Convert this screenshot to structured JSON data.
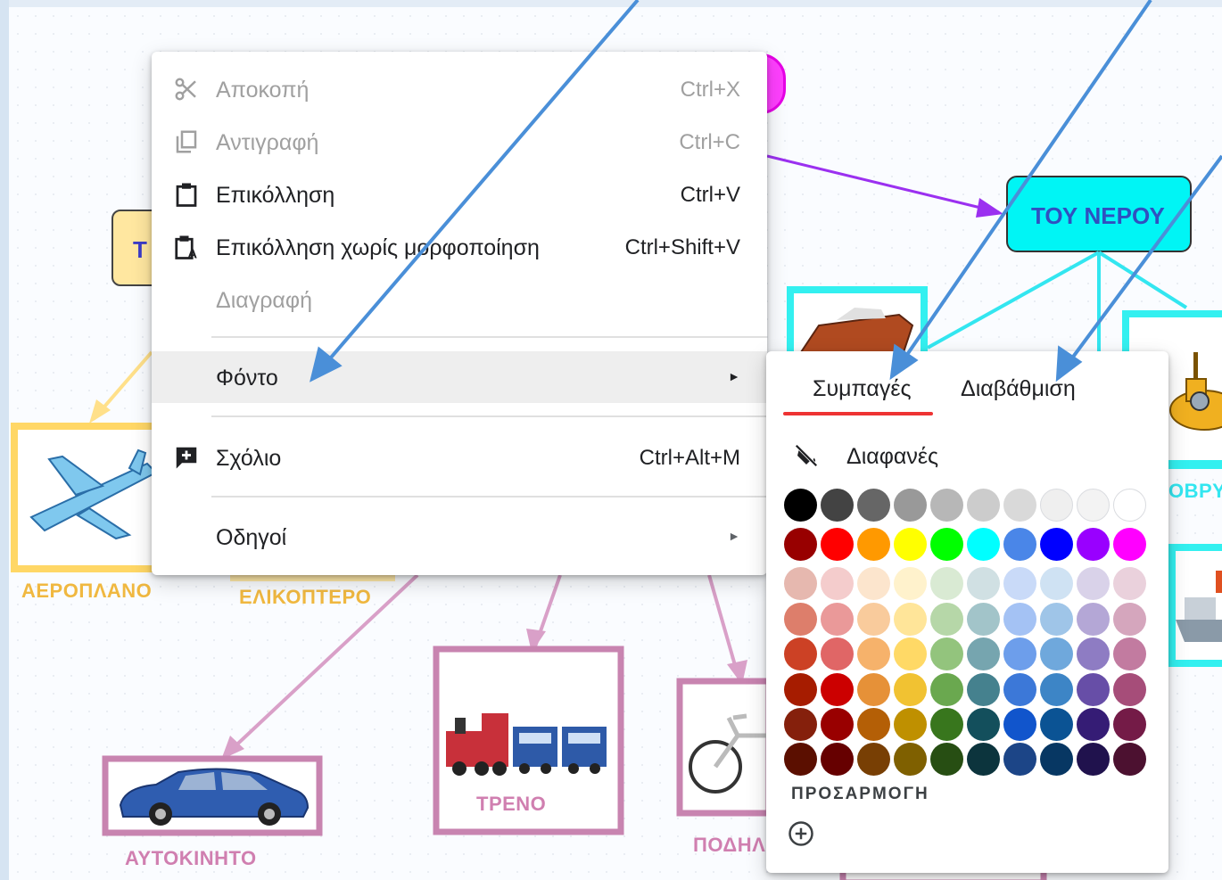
{
  "menu": {
    "items": [
      {
        "label": "Αποκοπή",
        "shortcut": "Ctrl+X",
        "icon": "scissors-icon"
      },
      {
        "label": "Αντιγραφή",
        "shortcut": "Ctrl+C",
        "icon": "copy-icon"
      },
      {
        "label": "Επικόλληση",
        "shortcut": "Ctrl+V",
        "icon": "paste-icon"
      },
      {
        "label": "Επικόλληση χωρίς μορφοποίηση",
        "shortcut": "Ctrl+Shift+V",
        "icon": "paste-plain-icon"
      },
      {
        "label": "Διαγραφή",
        "shortcut": ""
      },
      {
        "label": "Φόντο",
        "shortcut": "",
        "submenu": true
      },
      {
        "label": "Σχόλιο",
        "shortcut": "Ctrl+Alt+M",
        "icon": "add-comment-icon"
      },
      {
        "label": "Οδηγοί",
        "shortcut": "",
        "submenu": true
      }
    ],
    "submenu_arrow": "►"
  },
  "palette": {
    "tabs": [
      "Συμπαγές",
      "Διαβάθμιση"
    ],
    "transparent_label": "Διαφανές",
    "custom_label": "ΠΡΟΣΑΡΜΟΓΗ",
    "rows": [
      [
        "#000000",
        "#434343",
        "#666666",
        "#999999",
        "#b7b7b7",
        "#cccccc",
        "#d9d9d9",
        "#efefef",
        "#f3f3f3",
        "#ffffff"
      ],
      [
        "#980000",
        "#ff0000",
        "#ff9900",
        "#ffff00",
        "#00ff00",
        "#00ffff",
        "#4a86e8",
        "#0000ff",
        "#9900ff",
        "#ff00ff"
      ],
      [
        "#e6b8af",
        "#f4cccc",
        "#fce5cd",
        "#fff2cc",
        "#d9ead3",
        "#d0e0e3",
        "#c9daf8",
        "#cfe2f3",
        "#d9d2e9",
        "#ead1dc"
      ],
      [
        "#dd7e6b",
        "#ea9999",
        "#f9cb9c",
        "#ffe599",
        "#b6d7a8",
        "#a2c4c9",
        "#a4c2f4",
        "#9fc5e8",
        "#b4a7d6",
        "#d5a6bd"
      ],
      [
        "#cc4125",
        "#e06666",
        "#f6b26b",
        "#ffd966",
        "#93c47d",
        "#76a5af",
        "#6d9eeb",
        "#6fa8dc",
        "#8e7cc3",
        "#c27ba0"
      ],
      [
        "#a61c00",
        "#cc0000",
        "#e69138",
        "#f1c232",
        "#6aa84f",
        "#45818e",
        "#3c78d8",
        "#3d85c6",
        "#674ea7",
        "#a64d79"
      ],
      [
        "#85200c",
        "#990000",
        "#b45f06",
        "#bf9000",
        "#38761d",
        "#134f5c",
        "#1155cc",
        "#0b5394",
        "#351c75",
        "#741b47"
      ],
      [
        "#5b0f00",
        "#660000",
        "#783f04",
        "#7f6000",
        "#274e13",
        "#0c343d",
        "#1c4587",
        "#073763",
        "#20124d",
        "#4c1130"
      ]
    ]
  },
  "diagram": {
    "water_node": "ΤΟΥ ΝΕΡΟΥ",
    "yellow_node_partial": "Τ",
    "labels": {
      "airplane": "ΑΕΡΟΠΛΑΝΟ",
      "helicopter": "ΕΛΙΚΟΠΤΕΡΟ",
      "train": "ΤΡΕΝΟ",
      "car": "ΑΥΤΟΚΙΝΗΤΟ",
      "bicycle_partial": "ΠΟΔΗΛ",
      "submarine_partial": "ΟΒΡΥ"
    }
  },
  "colors": {
    "annotation_arrow": "#4a8fd8",
    "tab_underline": "#e33333",
    "water_node_bg": "#00f5f5",
    "menu_highlight": "#eeeeee"
  }
}
